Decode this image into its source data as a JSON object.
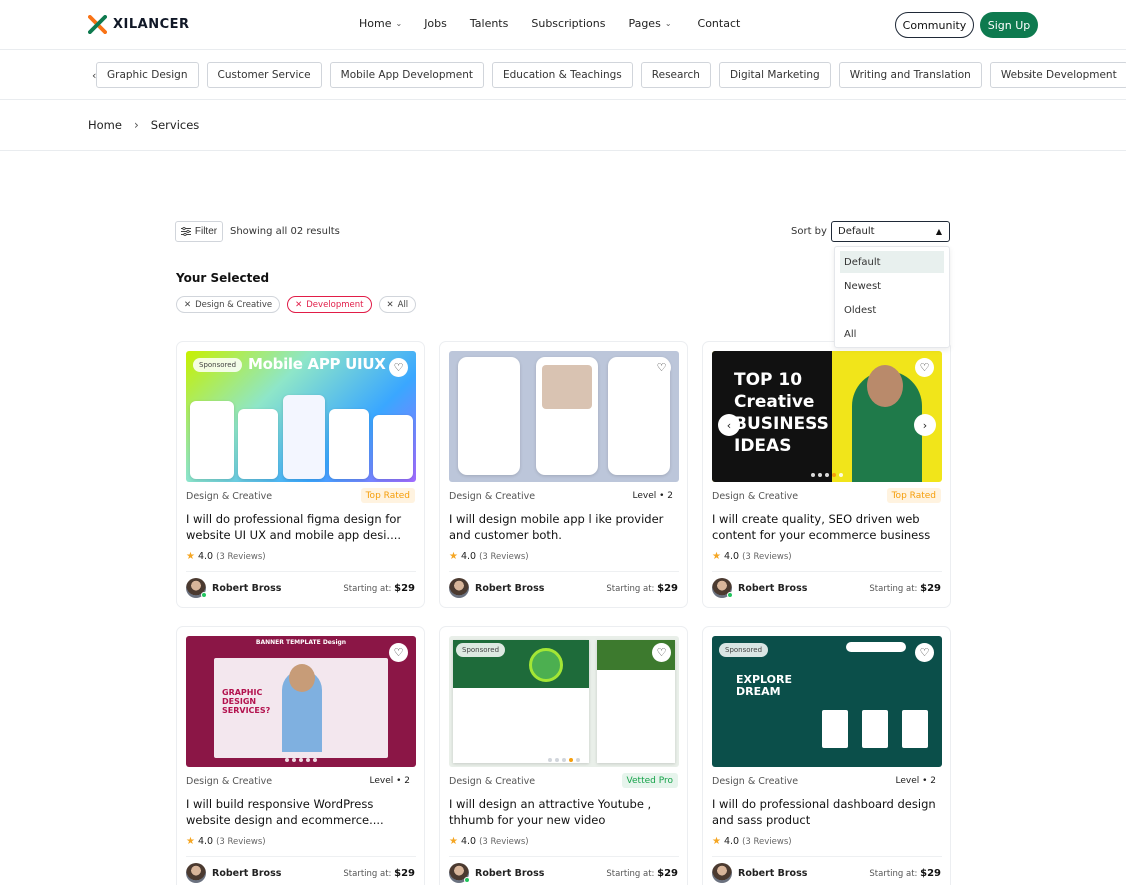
{
  "brand": {
    "name": "XILANCER",
    "accent": "#0e7a4f"
  },
  "nav": [
    {
      "label": "Home",
      "dropdown": true
    },
    {
      "label": "Jobs",
      "dropdown": false
    },
    {
      "label": "Talents",
      "dropdown": false
    },
    {
      "label": "Subscriptions",
      "dropdown": false
    },
    {
      "label": "Pages",
      "dropdown": true
    },
    {
      "label": "Contact",
      "dropdown": false
    }
  ],
  "header_actions": {
    "community": "Community",
    "signup": "Sign Up"
  },
  "categories": [
    "Graphic Design",
    "Customer Service",
    "Mobile App Development",
    "Education & Teachings",
    "Research",
    "Digital Marketing",
    "Writing and Translation",
    "Website Development"
  ],
  "breadcrumb": {
    "home": "Home",
    "current": "Services"
  },
  "toolbar": {
    "filter": "Filter",
    "results": "Showing all 02 results",
    "sort_label": "Sort by",
    "sort_value": "Default",
    "sort_options": [
      "Default",
      "Newest",
      "Oldest",
      "All"
    ]
  },
  "selected": {
    "title": "Your Selected",
    "chips": [
      "Design & Creative",
      "Development",
      "All"
    ]
  },
  "cards": [
    {
      "sponsored": "Sponsored",
      "thumb_text": "Mobile APP UIUX",
      "category": "Design & Creative",
      "badge": "Top Rated",
      "title": "I will do professional figma design for website  UI UX and mobile app desi....",
      "rating": "4.0",
      "reviews": "(3 Reviews)",
      "author": "Robert Bross",
      "price_label": "Starting at:",
      "price": "$29"
    },
    {
      "sponsored": "",
      "thumb_text": "",
      "category": "Design & Creative",
      "badge": "Level • 2",
      "title": "I will design mobile app l ike provider and customer both.",
      "rating": "4.0",
      "reviews": "(3 Reviews)",
      "author": "Robert Bross",
      "price_label": "Starting at:",
      "price": "$29"
    },
    {
      "sponsored": "",
      "thumb_text": "TOP 10 Creative BUSINESS IDEAS",
      "category": "Design & Creative",
      "badge": "Top Rated",
      "title": "I will create quality, SEO driven web content for your ecommerce business",
      "rating": "4.0",
      "reviews": "(3 Reviews)",
      "author": "Robert Bross",
      "price_label": "Starting at:",
      "price": "$29"
    },
    {
      "sponsored": "",
      "thumb_text": "BANNER TEMPLATE Design",
      "category": "Design & Creative",
      "badge": "Level • 2",
      "title": "I will build responsive WordPress website design and ecommerce....",
      "rating": "4.0",
      "reviews": "(3 Reviews)",
      "author": "Robert Bross",
      "price_label": "Starting at:",
      "price": "$29"
    },
    {
      "sponsored": "Sponsored",
      "thumb_text": "",
      "category": "Design & Creative",
      "badge": "Vetted Pro",
      "title": "I will design an attractive Youtube , thhumb for your new video",
      "rating": "4.0",
      "reviews": "(3 Reviews)",
      "author": "Robert Bross",
      "price_label": "Starting at:",
      "price": "$29"
    },
    {
      "sponsored": "Sponsored",
      "thumb_text": "EXPLORE DREAM",
      "category": "Design & Creative",
      "badge": "Level • 2",
      "title": "I will do professional dashboard design and sass product",
      "rating": "4.0",
      "reviews": "(3 Reviews)",
      "author": "Robert Bross",
      "price_label": "Starting at:",
      "price": "$29"
    }
  ]
}
